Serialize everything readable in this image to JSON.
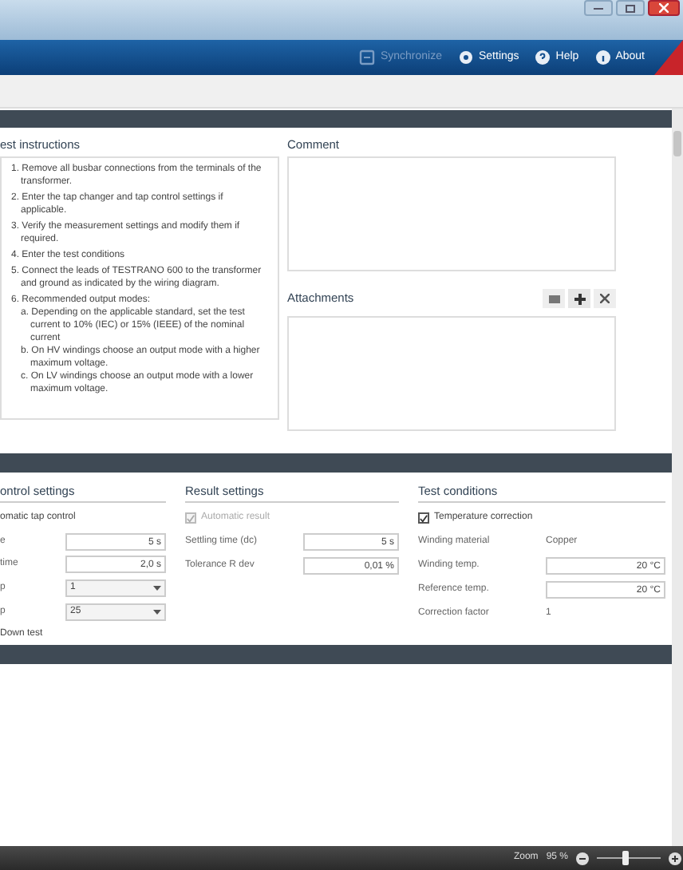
{
  "toolbar": [
    {
      "label": "Synchronize",
      "disabled": true
    },
    {
      "label": "Settings",
      "disabled": false
    },
    {
      "label": "Help",
      "disabled": false
    },
    {
      "label": "About",
      "disabled": false
    }
  ],
  "instructions": {
    "title": "est instructions",
    "items": [
      {
        "text": "1. Remove all busbar connections from the terminals of the transformer."
      },
      {
        "text": "2. Enter the tap changer and tap control settings if applicable."
      },
      {
        "text": "3. Verify the measurement settings and modify them if required."
      },
      {
        "text": "4. Enter the test conditions"
      },
      {
        "text": "5. Connect the leads of TESTRANO 600 to the transformer and ground as indicated by the wiring diagram."
      },
      {
        "text": "6. Recommended output modes:",
        "subitems": [
          "a. Depending on the applicable standard, set the test current to 10% (IEC) or 15% (IEEE) of the nominal current",
          "b. On HV windings choose an output mode with a higher maximum voltage.",
          "c. On LV windings choose an output mode with a lower maximum voltage."
        ]
      }
    ]
  },
  "comment": {
    "title": "Comment"
  },
  "attachments": {
    "title": "Attachments"
  },
  "sections": [
    {
      "title": "ontrol settings",
      "rows": [
        {
          "kind": "text",
          "label": "omatic tap control"
        },
        {
          "kind": "field",
          "label": "e",
          "value": "5 s"
        },
        {
          "kind": "field",
          "label": "time",
          "value": "2,0 s"
        },
        {
          "kind": "dropdown",
          "label": "p",
          "value": "1"
        },
        {
          "kind": "dropdown",
          "label": "p",
          "value": "25"
        },
        {
          "kind": "text",
          "label": "Down test"
        }
      ]
    },
    {
      "title": "Result settings",
      "rows": [
        {
          "kind": "checkbox",
          "label": "Automatic result",
          "checked": true,
          "disabled": true
        },
        {
          "kind": "field",
          "label": "Settling time (dc)",
          "value": "5 s"
        },
        {
          "kind": "field",
          "label": "Tolerance R dev",
          "value": "0,01 %"
        }
      ]
    },
    {
      "title": "Test conditions",
      "rows": [
        {
          "kind": "checkbox",
          "label": "Temperature correction",
          "checked": true,
          "disabled": false
        },
        {
          "kind": "value",
          "label": "Winding material",
          "value": "Copper"
        },
        {
          "kind": "field",
          "label": "Winding temp.",
          "value": "20 °C"
        },
        {
          "kind": "field",
          "label": "Reference temp.",
          "value": "20 °C"
        },
        {
          "kind": "value",
          "label": "Correction factor",
          "value": "1"
        }
      ]
    }
  ],
  "status_bar": {
    "zoom_label": "Zoom",
    "zoom_value": "95 %",
    "zoom_slider": {
      "level": 0.45
    }
  }
}
